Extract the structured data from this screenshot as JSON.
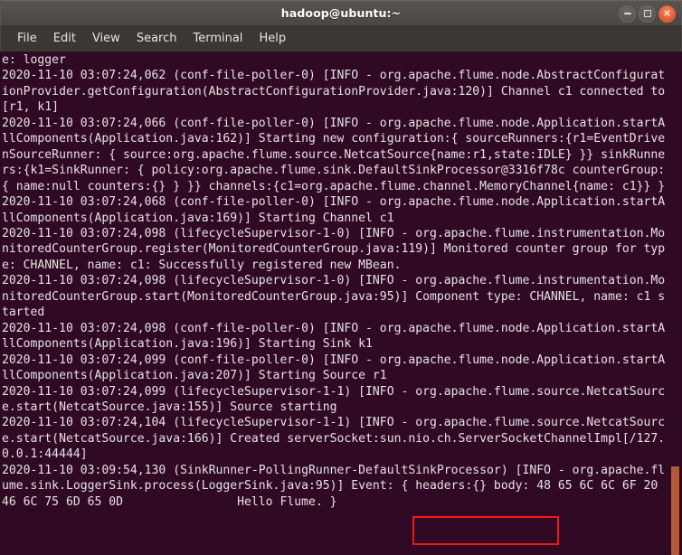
{
  "window": {
    "title": "hadoop@ubuntu:~",
    "controls": [
      {
        "name": "minimize",
        "glyph": ""
      },
      {
        "name": "maximize",
        "glyph": ""
      },
      {
        "name": "close",
        "glyph": "×"
      }
    ]
  },
  "menubar": {
    "items": [
      {
        "label": "File"
      },
      {
        "label": "Edit"
      },
      {
        "label": "View"
      },
      {
        "label": "Search"
      },
      {
        "label": "Terminal"
      },
      {
        "label": "Help"
      }
    ]
  },
  "terminal": {
    "background_color": "#300a24",
    "foreground_color": "#e8e1e4",
    "content": "e: logger\n2020-11-10 03:07:24,062 (conf-file-poller-0) [INFO - org.apache.flume.node.AbstractConfigurationProvider.getConfiguration(AbstractConfigurationProvider.java:120)] Channel c1 connected to [r1, k1]\n2020-11-10 03:07:24,066 (conf-file-poller-0) [INFO - org.apache.flume.node.Application.startAllComponents(Application.java:162)] Starting new configuration:{ sourceRunners:{r1=EventDrivenSourceRunner: { source:org.apache.flume.source.NetcatSource{name:r1,state:IDLE} }} sinkRunners:{k1=SinkRunner: { policy:org.apache.flume.sink.DefaultSinkProcessor@3316f78c counterGroup:{ name:null counters:{} } }} channels:{c1=org.apache.flume.channel.MemoryChannel{name: c1}} }\n2020-11-10 03:07:24,068 (conf-file-poller-0) [INFO - org.apache.flume.node.Application.startAllComponents(Application.java:169)] Starting Channel c1\n2020-11-10 03:07:24,098 (lifecycleSupervisor-1-0) [INFO - org.apache.flume.instrumentation.MonitoredCounterGroup.register(MonitoredCounterGroup.java:119)] Monitored counter group for type: CHANNEL, name: c1: Successfully registered new MBean.\n2020-11-10 03:07:24,098 (lifecycleSupervisor-1-0) [INFO - org.apache.flume.instrumentation.MonitoredCounterGroup.start(MonitoredCounterGroup.java:95)] Component type: CHANNEL, name: c1 started\n2020-11-10 03:07:24,098 (conf-file-poller-0) [INFO - org.apache.flume.node.Application.startAllComponents(Application.java:196)] Starting Sink k1\n2020-11-10 03:07:24,099 (conf-file-poller-0) [INFO - org.apache.flume.node.Application.startAllComponents(Application.java:207)] Starting Source r1\n2020-11-10 03:07:24,099 (lifecycleSupervisor-1-1) [INFO - org.apache.flume.source.NetcatSource.start(NetcatSource.java:155)] Source starting\n2020-11-10 03:07:24,104 (lifecycleSupervisor-1-1) [INFO - org.apache.flume.source.NetcatSource.start(NetcatSource.java:166)] Created serverSocket:sun.nio.ch.ServerSocketChannelImpl[/127.0.0.1:44444]\n2020-11-10 03:09:54,130 (SinkRunner-PollingRunner-DefaultSinkProcessor) [INFO - org.apache.flume.sink.LoggerSink.process(LoggerSink.java:95)] Event: { headers:{} body: 48 65 6C 6C 6F 20 46 6C 75 6D 65 0D                Hello Flume. }"
  },
  "annotation": {
    "color": "#f41616",
    "highlighted_text": "Hello Flume. }"
  },
  "scrollbar": {
    "thumb_color": "#b55a38"
  }
}
